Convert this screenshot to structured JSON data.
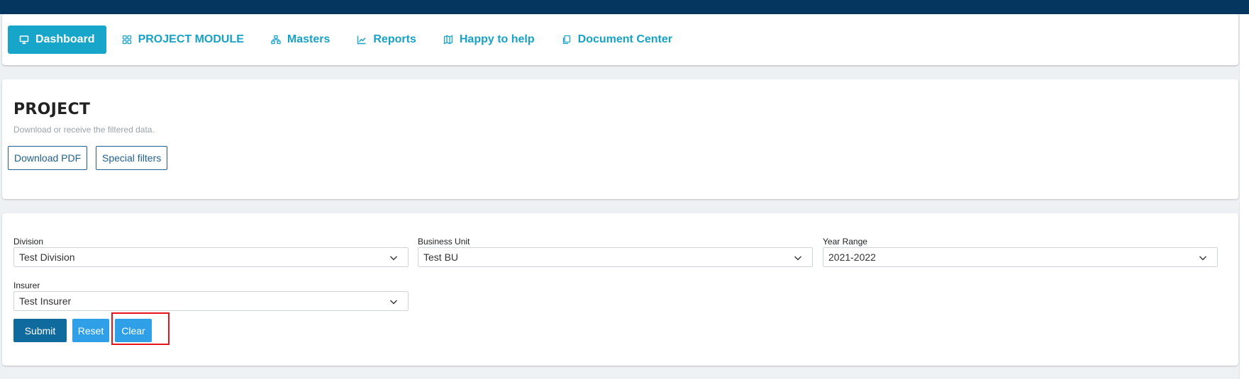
{
  "nav": {
    "items": [
      {
        "label": "Dashboard",
        "icon": "monitor-icon",
        "active": true
      },
      {
        "label": "PROJECT MODULE",
        "icon": "grid-icon",
        "active": false
      },
      {
        "label": "Masters",
        "icon": "hierarchy-icon",
        "active": false
      },
      {
        "label": "Reports",
        "icon": "trend-chart-icon",
        "active": false
      },
      {
        "label": "Happy to help",
        "icon": "map-icon",
        "active": false
      },
      {
        "label": "Document Center",
        "icon": "copy-icon",
        "active": false
      }
    ]
  },
  "project": {
    "title": "PROJECT",
    "subtitle": "Download or receive the filtered data.",
    "download_pdf_label": "Download PDF",
    "special_filters_label": "Special filters"
  },
  "filters": {
    "division": {
      "label": "Division",
      "value": "Test Division"
    },
    "business_unit": {
      "label": "Business Unit",
      "value": "Test BU"
    },
    "year_range": {
      "label": "Year Range",
      "value": "2021-2022"
    },
    "insurer": {
      "label": "Insurer",
      "value": "Test Insurer"
    },
    "submit_label": "Submit",
    "reset_label": "Reset",
    "clear_label": "Clear"
  },
  "colors": {
    "topbar": "#05365f",
    "accent": "#17a6c9",
    "submit": "#0f6a9e",
    "secondary": "#2f9fe8",
    "highlight": "#e8141b"
  }
}
